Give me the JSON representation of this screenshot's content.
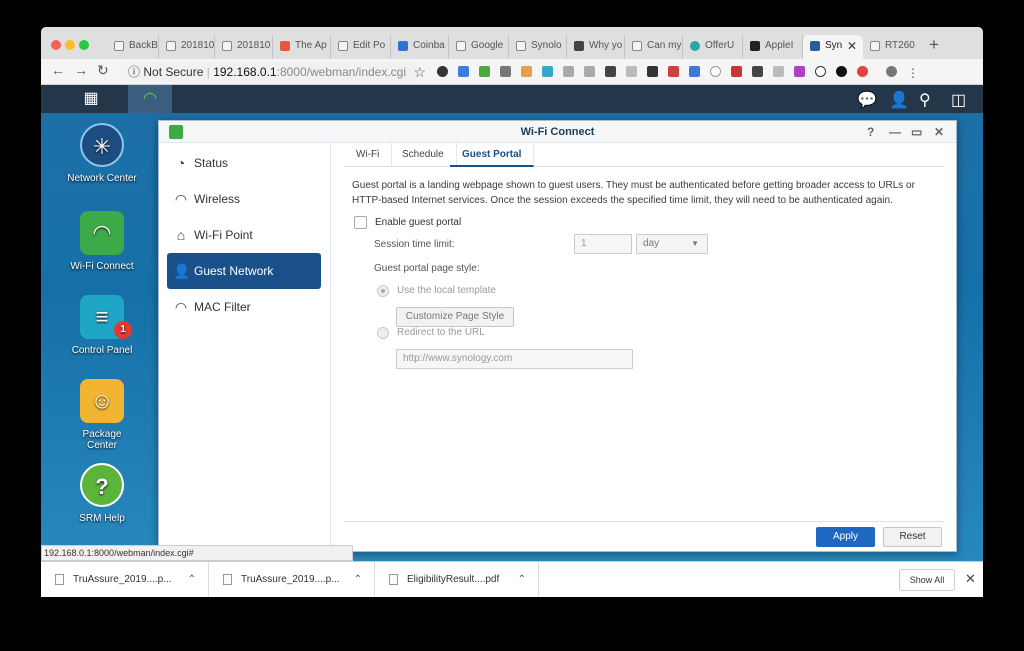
{
  "browser": {
    "tabs": [
      {
        "label": "BackBe"
      },
      {
        "label": "201810"
      },
      {
        "label": "201810"
      },
      {
        "label": "The Ap"
      },
      {
        "label": "Edit Po"
      },
      {
        "label": "Coinba"
      },
      {
        "label": "Google"
      },
      {
        "label": "Synolo"
      },
      {
        "label": "Why yo"
      },
      {
        "label": "Can my"
      },
      {
        "label": "OfferU"
      },
      {
        "label": "AppleI"
      },
      {
        "label": "Syn"
      },
      {
        "label": "RT260"
      }
    ],
    "new_tab": "+",
    "security": "Not Secure",
    "url_host": "192.168.0.1",
    "url_path": ":8000/webman/index.cgi"
  },
  "dialog": {
    "title": "Wi-Fi Connect",
    "sidebar": [
      {
        "label": "Status"
      },
      {
        "label": "Wireless"
      },
      {
        "label": "Wi-Fi Point"
      },
      {
        "label": "Guest Network"
      },
      {
        "label": "MAC Filter"
      }
    ],
    "tabs": [
      {
        "label": "Wi-Fi"
      },
      {
        "label": "Schedule"
      },
      {
        "label": "Guest Portal"
      }
    ],
    "description": "Guest portal is a landing webpage shown to guest users. They must be authenticated before getting broader access to URLs or HTTP-based Internet services. Once the session exceeds the specified time limit, they will need to be authenticated again.",
    "enable_label": "Enable guest portal",
    "session_label": "Session time limit:",
    "session_value": "1",
    "session_unit": "day",
    "style_label": "Guest portal page style:",
    "local_template_label": "Use the local template",
    "customize_button": "Customize Page Style",
    "redirect_label": "Redirect to the URL",
    "redirect_url": "http://www.synology.com",
    "apply": "Apply",
    "reset": "Reset"
  },
  "desktop": [
    {
      "label": "Network Center"
    },
    {
      "label": "Wi-Fi Connect"
    },
    {
      "label": "Control Panel",
      "badge": "1"
    },
    {
      "label": "Package Center"
    },
    {
      "label": "SRM Help"
    }
  ],
  "status_url": "192.168.0.1:8000/webman/index.cgi#",
  "downloads": [
    {
      "label": "TruAssure_2019....p..."
    },
    {
      "label": "TruAssure_2019....p..."
    },
    {
      "label": "EligibilityResult....pdf"
    }
  ],
  "show_all": "Show All"
}
